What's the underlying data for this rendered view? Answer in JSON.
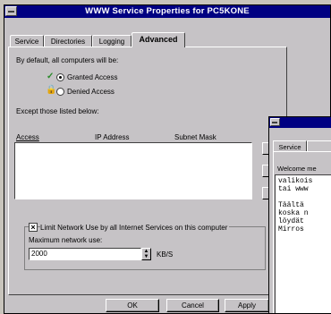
{
  "dialog": {
    "title": "WWW Service Properties for PC5KONE",
    "tabs": [
      "Service",
      "Directories",
      "Logging",
      "Advanced"
    ],
    "default_label": "By default, all computers will be:",
    "granted_label": "Granted Access",
    "denied_label": "Denied Access",
    "except_label": "Except those listed below:",
    "columns": [
      "Access",
      "IP Address",
      "Subnet Mask"
    ],
    "limit_label": "Limit Network Use by all Internet Services on this computer",
    "max_label": "Maximum network use:",
    "max_value": "2000",
    "unit": "KB/S",
    "buttons": [
      "OK",
      "Cancel",
      "Apply"
    ]
  },
  "second_window": {
    "tabs": [
      "Service",
      ""
    ],
    "welcome_label": "Welcome me",
    "text": "valikois\ntai www\n\nTäältä\nkoska n\nlöydät\nMirros"
  }
}
